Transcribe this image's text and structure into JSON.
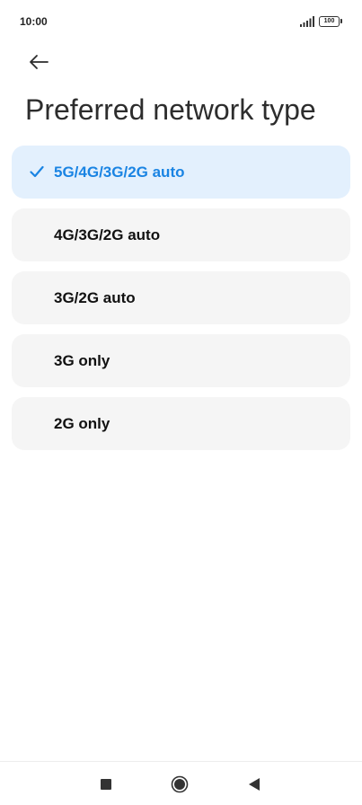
{
  "status_bar": {
    "time": "10:00",
    "battery": "100"
  },
  "header": {
    "title": "Preferred network type"
  },
  "options": [
    {
      "label": "5G/4G/3G/2G auto",
      "selected": true
    },
    {
      "label": "4G/3G/2G auto",
      "selected": false
    },
    {
      "label": "3G/2G auto",
      "selected": false
    },
    {
      "label": "3G only",
      "selected": false
    },
    {
      "label": "2G only",
      "selected": false
    }
  ],
  "colors": {
    "accent": "#1a84e3",
    "selected_bg": "#e3f0fd",
    "item_bg": "#f5f5f5"
  },
  "icons": {
    "back": "arrow-left-icon",
    "check": "check-icon",
    "signal": "signal-icon",
    "battery": "battery-icon",
    "nav_recents": "square-icon",
    "nav_home": "circle-icon",
    "nav_back": "triangle-left-icon"
  }
}
